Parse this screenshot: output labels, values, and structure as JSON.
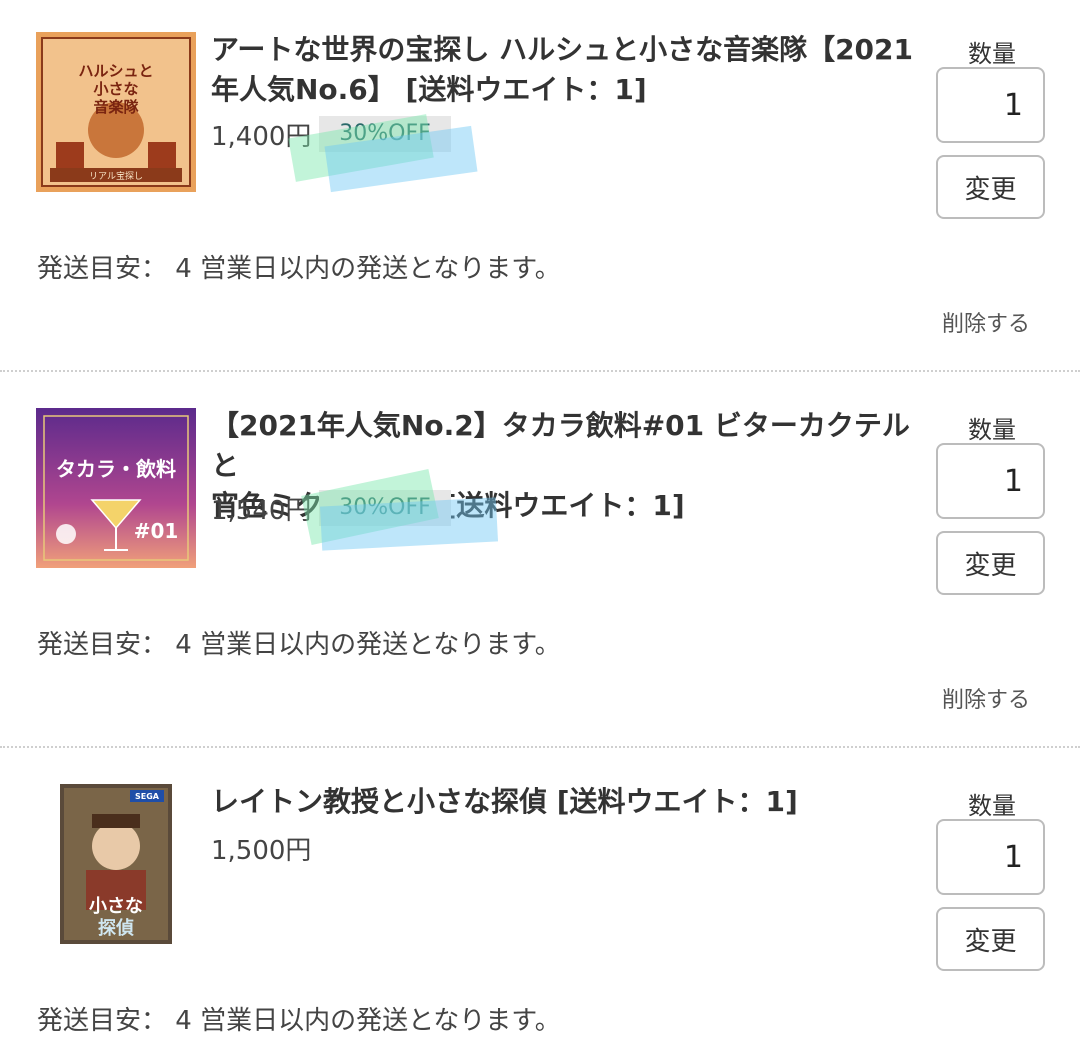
{
  "items": [
    {
      "title_line1": "アートな世界の宝探し ハルシュと小さな音楽隊【2021",
      "title_line2": "年人気No.6】 [送料ウエイト：1]",
      "price": "1,400円",
      "discount": "30%OFF",
      "qty_label": "数量",
      "qty_value": "1",
      "change_label": "変更",
      "shipping": "発送目安： 4 営業日以内の発送となります。",
      "delete_label": "削除する",
      "thumb_text_line1": "ハルシュと",
      "thumb_text_line2": "小さな",
      "thumb_text_line3": "音楽隊",
      "thumb_publisher": "リアル宝探し"
    },
    {
      "title_line1": "【2021年人気No.2】タカラ飲料#01 ビターカクテルと",
      "title_line2": "宵色ミクスチャー [送料ウエイト：1]",
      "price": "1,540円",
      "discount": "30%OFF",
      "qty_label": "数量",
      "qty_value": "1",
      "change_label": "変更",
      "shipping": "発送目安： 4 営業日以内の発送となります。",
      "delete_label": "削除する",
      "thumb_text_line1": "タカラ・飲料",
      "thumb_text_line2": "#01"
    },
    {
      "title_line1": "レイトン教授と小さな探偵 [送料ウエイト：1]",
      "price": "1,500円",
      "qty_label": "数量",
      "qty_value": "1",
      "change_label": "変更",
      "shipping": "発送目安： 4 営業日以内の発送となります。",
      "thumb_text_line1": "小さな",
      "thumb_text_line2": "探偵",
      "thumb_brand": "SEGA"
    }
  ]
}
